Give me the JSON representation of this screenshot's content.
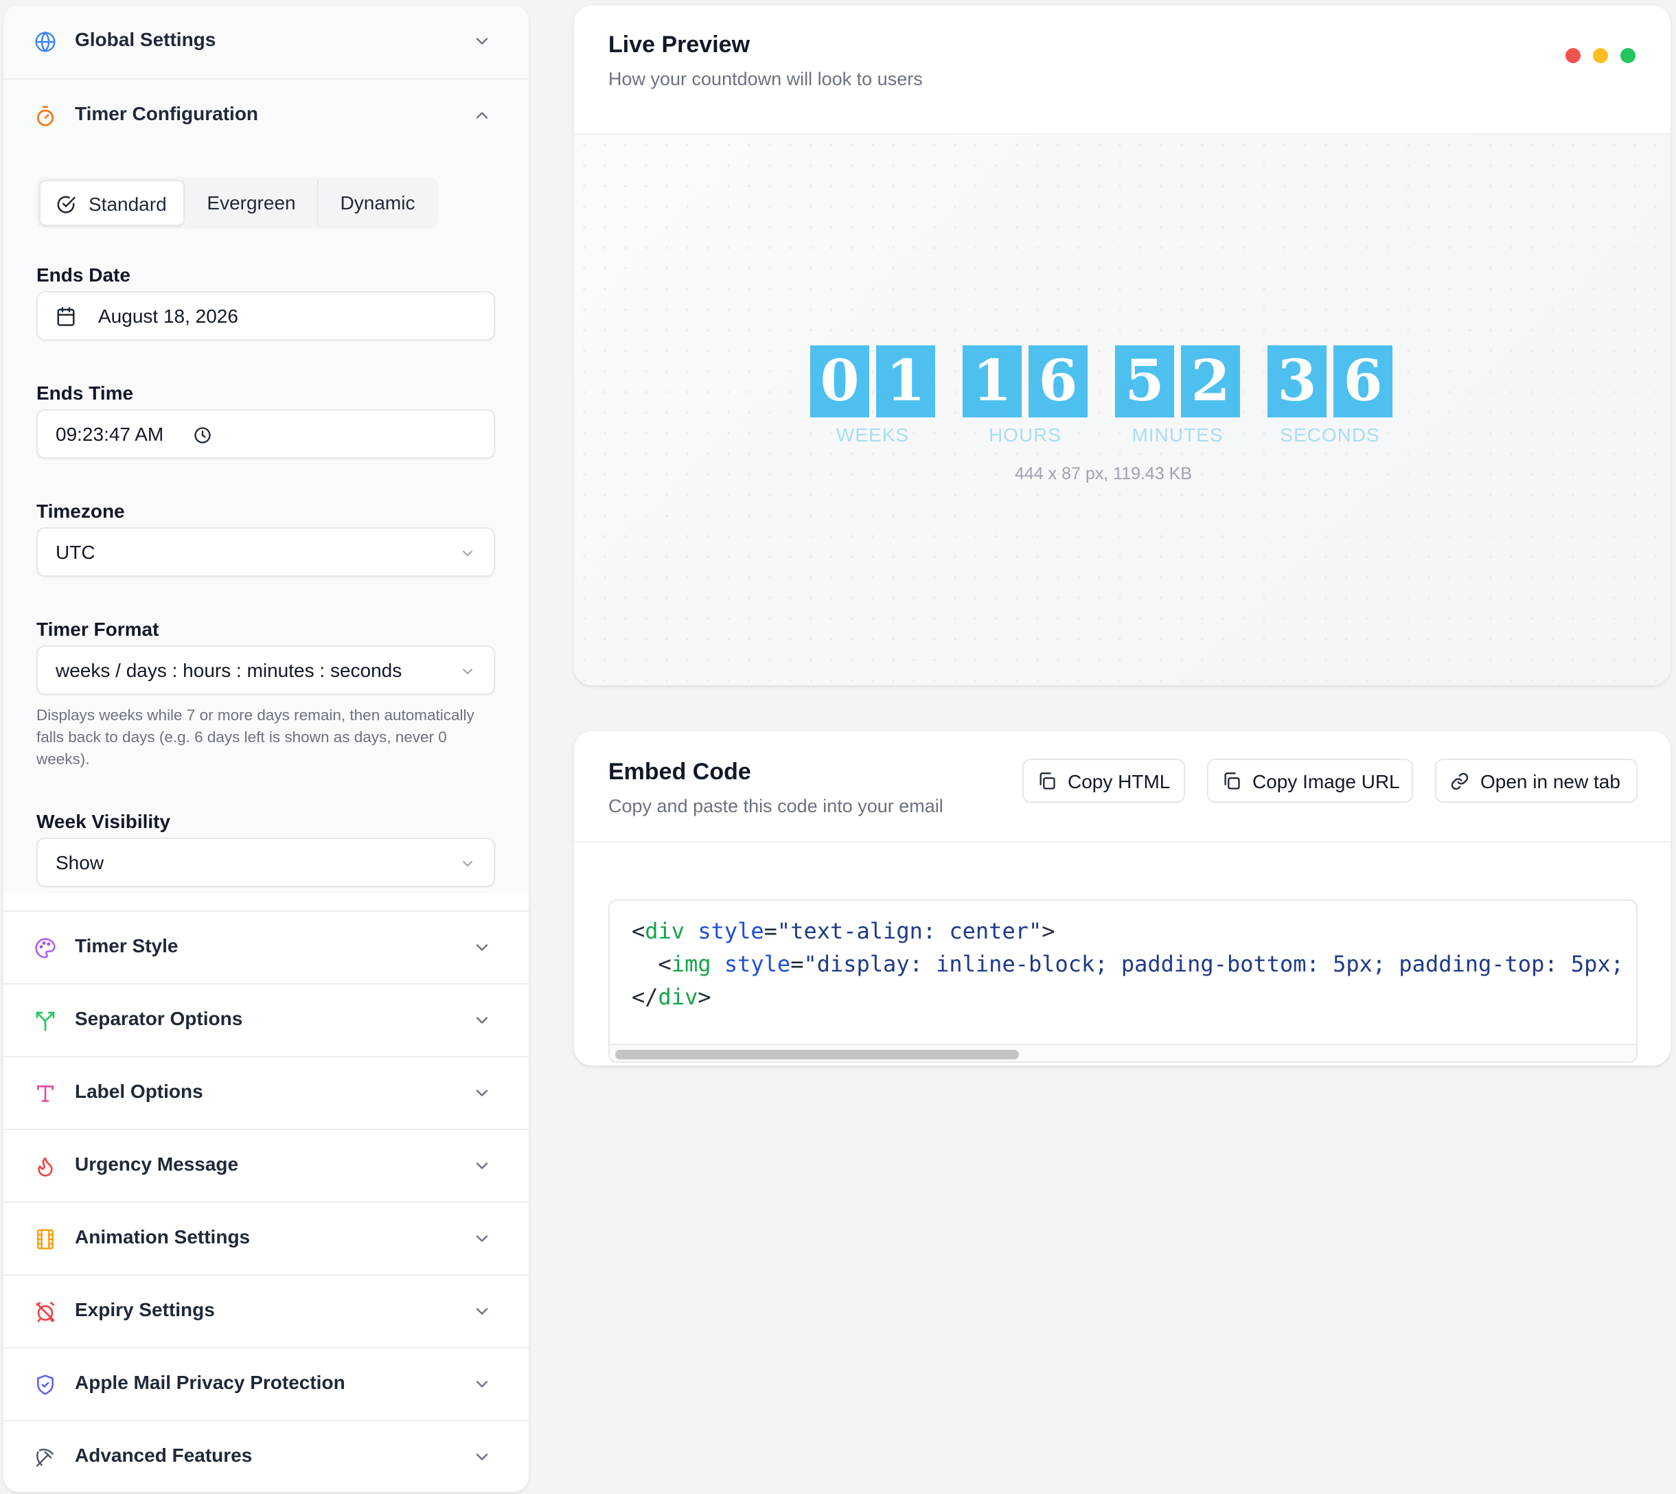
{
  "sidebar": {
    "sections_top": [
      {
        "title": "Global Settings",
        "icon": "globe-icon"
      },
      {
        "title": "Timer Configuration",
        "icon": "stopwatch-icon"
      }
    ],
    "timer_config": {
      "modes": [
        "Standard",
        "Evergreen",
        "Dynamic"
      ],
      "active_mode": "Standard",
      "ends_date_label": "Ends Date",
      "ends_date_value": "August 18, 2026",
      "ends_time_label": "Ends Time",
      "ends_time_value": "09:23:47 AM",
      "timezone_label": "Timezone",
      "timezone_value": "UTC",
      "timer_format_label": "Timer Format",
      "timer_format_value": "weeks / days : hours : minutes : seconds",
      "timer_format_help": "Displays weeks while 7 or more days remain, then automatically falls back to days (e.g. 6 days left is shown as days, never 0 weeks).",
      "week_visibility_label": "Week Visibility",
      "week_visibility_value": "Show"
    },
    "sections_bottom": [
      {
        "title": "Timer Style",
        "icon": "palette-icon",
        "color": "#a855f7"
      },
      {
        "title": "Separator Options",
        "icon": "split-icon",
        "color": "#22c55e"
      },
      {
        "title": "Label Options",
        "icon": "type-icon",
        "color": "#ec4899"
      },
      {
        "title": "Urgency Message",
        "icon": "flame-icon",
        "color": "#ef4444"
      },
      {
        "title": "Animation Settings",
        "icon": "film-icon",
        "color": "#f59e0b"
      },
      {
        "title": "Expiry Settings",
        "icon": "alarm-off-icon",
        "color": "#ef4444"
      },
      {
        "title": "Apple Mail Privacy Protection",
        "icon": "shield-check-icon",
        "color": "#6366f1"
      },
      {
        "title": "Advanced Features",
        "icon": "pickaxe-icon",
        "color": "#6b7280"
      }
    ]
  },
  "preview": {
    "title": "Live Preview",
    "subtitle": "How your countdown will look to users",
    "window_dots": [
      "#ef5350",
      "#fbbf24",
      "#22c55e"
    ],
    "digits": [
      "0",
      "1",
      "1",
      "6",
      "5",
      "2",
      "3",
      "6"
    ],
    "units": [
      "WEEKS",
      "HOURS",
      "MINUTES",
      "SECONDS"
    ],
    "image_info": "444 x 87 px, 119.43 KB",
    "digit_color": "#4dc0ef"
  },
  "embed": {
    "title": "Embed Code",
    "subtitle": "Copy and paste this code into your email",
    "buttons": [
      {
        "label": "Copy HTML",
        "icon": "copy-icon"
      },
      {
        "label": "Copy Image URL",
        "icon": "copy-icon"
      },
      {
        "label": "Open in new tab",
        "icon": "link-icon"
      }
    ],
    "code": {
      "line1": {
        "open": "<",
        "tag": "div",
        "attr": "style",
        "eq": "=",
        "val": "\"text-align: center\"",
        "close": ">"
      },
      "line2": {
        "indent": "  ",
        "open": "<",
        "tag": "img",
        "attr": "style",
        "eq": "=",
        "val": "\"display: inline-block; padding-bottom: 5px; padding-top: 5px;"
      },
      "line3": {
        "open": "</",
        "tag": "div",
        "close": ">"
      }
    }
  }
}
